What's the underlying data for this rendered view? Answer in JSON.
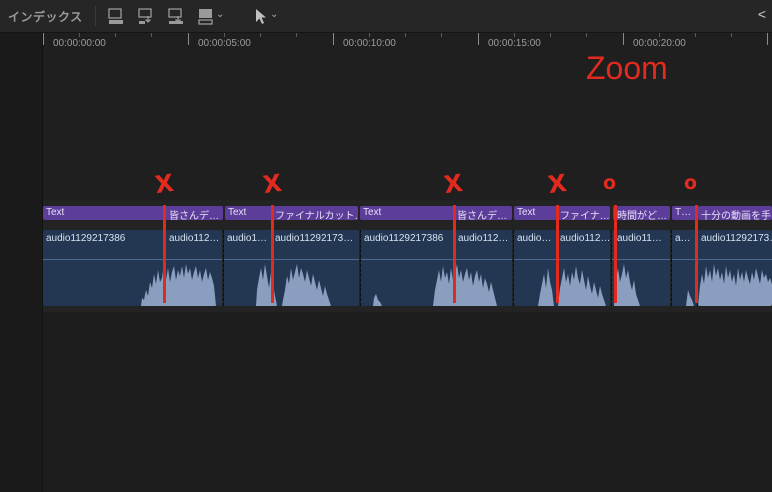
{
  "toolbar": {
    "title": "インデックス",
    "icons": [
      "append-clip-icon",
      "insert-clip-icon",
      "overwrite-clip-icon",
      "connect-clip-icon",
      "select-tool-icon"
    ],
    "chevron": "⌄",
    "right_arrow": "<"
  },
  "ruler": {
    "labels": [
      "00:00:00:00",
      "00:00:05:00",
      "00:00:10:00",
      "00:00:15:00",
      "00:00:20:00"
    ]
  },
  "clips": {
    "titles": [
      "Text",
      "皆さんデ…",
      "Text",
      "ファイナルカット…",
      "Text",
      "皆さんデ…",
      "Text",
      "ファイナ…",
      "時間がど…",
      "T…",
      "十分の動画を手…"
    ],
    "audio": [
      "audio1129217386",
      "audio112…",
      "audio1…",
      "audio11292173…",
      "audio1129217386",
      "audio112…",
      "audio…",
      "audio112…",
      "audio11…",
      "a…",
      "audio11292173…"
    ]
  },
  "annotations": {
    "zoom": "Zoom",
    "marks": [
      "X",
      "X",
      "X",
      "X",
      "o",
      "o"
    ],
    "color": "#e32a1f"
  },
  "colors": {
    "title_clip": "#5c3d9a",
    "audio_clip": "#233752",
    "waveform": "#8a9fc0"
  }
}
